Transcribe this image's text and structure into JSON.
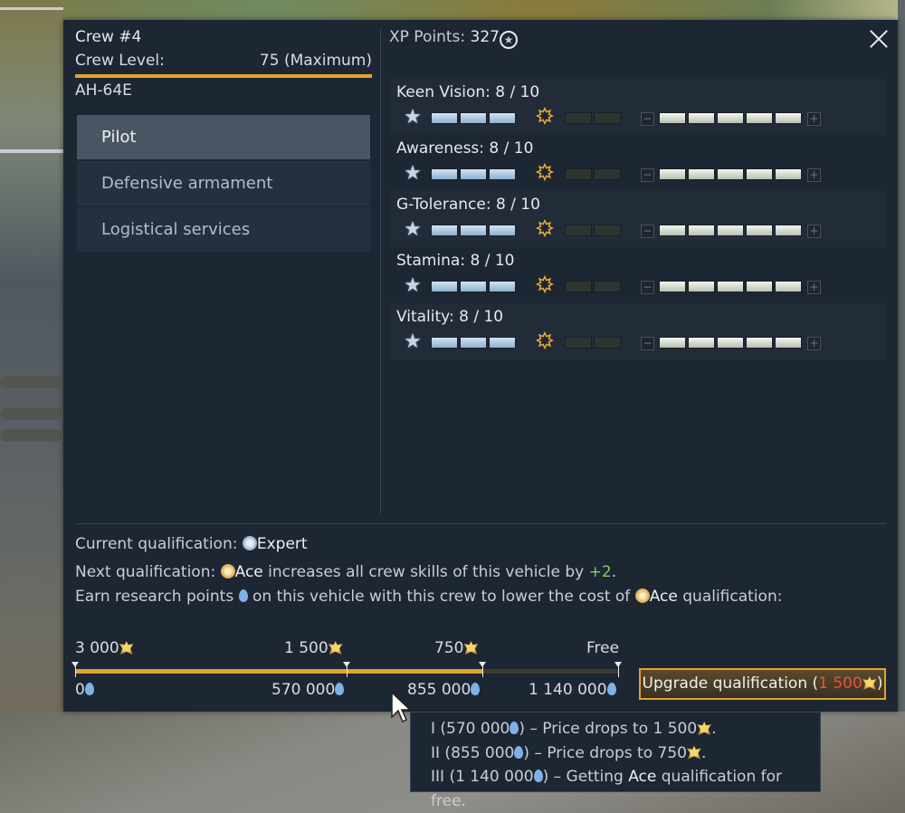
{
  "crew": {
    "title": "Crew #4",
    "level_label": "Crew Level:",
    "level_value": "75 (Maximum)",
    "vehicle": "AH-64E"
  },
  "tabs": [
    "Pilot",
    "Defensive armament",
    "Logistical services"
  ],
  "xp": {
    "label": "XP Points: ",
    "value": "327",
    "icon": "star-circle-icon"
  },
  "skills": [
    {
      "label": "Keen Vision: 8 / 10"
    },
    {
      "label": "Awareness: 8 / 10"
    },
    {
      "label": "G-Tolerance: 8 / 10"
    },
    {
      "label": "Stamina: 8 / 10"
    },
    {
      "label": "Vitality: 8 / 10"
    }
  ],
  "skill_levels": {
    "expert_segments": 3,
    "ace_segments": 2,
    "points": 5
  },
  "qualification": {
    "current_label": "Current qualification: ",
    "current_value": "Expert",
    "next_label": "Next qualification: ",
    "next_value": "Ace",
    "next_text": " increases all crew skills of this vehicle by ",
    "bonus": "+2",
    "bonus_suffix": ".",
    "earn_text_1": "Earn research points ",
    "earn_text_2": " on this vehicle with this crew to lower the cost of ",
    "earn_value": "Ace",
    "earn_text_3": " qualification:"
  },
  "progress": {
    "fraction": 0.75,
    "prices": [
      "3 000",
      "1 500",
      "750",
      "Free"
    ],
    "thresholds": [
      "0",
      "570 000",
      "855 000",
      "1 140 000"
    ]
  },
  "upgrade": {
    "label": "Upgrade qualification (",
    "cost": "1 500",
    "suffix": ")"
  },
  "tooltip": {
    "line1_a": "I (570 000",
    "line1_b": ") – Price drops to 1 500",
    "line1_c": ".",
    "line2_a": "II (855 000",
    "line2_b": ") – Price drops to 750",
    "line2_c": ".",
    "line3_a": "III (1 140 000",
    "line3_b": ") – Getting ",
    "line3_hl": "Ace",
    "line3_c": " qualification for free."
  },
  "colors": {
    "accent": "#e3a22a",
    "panel": "#1d2633",
    "bonus": "#7fd15a",
    "cost": "#e8543a"
  }
}
